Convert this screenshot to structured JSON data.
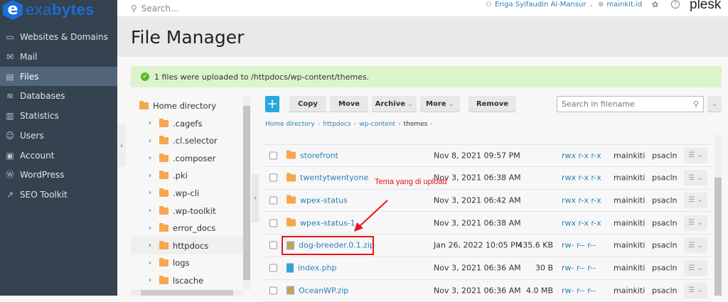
{
  "brand": {
    "logo_letter": "e",
    "logo_prefix": "exa",
    "logo_suffix": "bytes",
    "plesk": "plesk"
  },
  "topbar": {
    "search_placeholder": "Search...",
    "user": "Eriga Syifaudin Al-Mansur",
    "domain": "mainkit.id"
  },
  "sidebar": {
    "items": [
      {
        "label": "Websites & Domains",
        "icon": "monitor-icon"
      },
      {
        "label": "Mail",
        "icon": "mail-icon"
      },
      {
        "label": "Files",
        "icon": "folder-icon",
        "active": true
      },
      {
        "label": "Databases",
        "icon": "database-icon"
      },
      {
        "label": "Statistics",
        "icon": "chart-icon"
      },
      {
        "label": "Users",
        "icon": "user-icon"
      },
      {
        "label": "Account",
        "icon": "account-icon"
      },
      {
        "label": "WordPress",
        "icon": "wordpress-icon"
      },
      {
        "label": "SEO Toolkit",
        "icon": "seo-icon"
      }
    ]
  },
  "page": {
    "title": "File Manager",
    "banner": "1 files were uploaded to /httpdocs/wp-content/themes."
  },
  "tree": {
    "root": "Home directory",
    "items": [
      ".cagefs",
      ".cl.selector",
      ".composer",
      ".pki",
      ".wp-cli",
      ".wp-toolkit",
      "error_docs",
      "httpdocs",
      "logs",
      "lscache"
    ],
    "selected": "httpdocs"
  },
  "toolbar": {
    "add": "+",
    "copy": "Copy",
    "move": "Move",
    "archive": "Archive",
    "more": "More",
    "remove": "Remove",
    "search_placeholder": "Search in filename"
  },
  "breadcrumb": [
    "Home directory",
    "httpdocs",
    "wp-content",
    "themes"
  ],
  "files": [
    {
      "name": "storefront",
      "type": "folder",
      "date": "Nov 8, 2021 09:57 PM",
      "size": "",
      "perms": "rwx r-x r-x",
      "owner": "mainkiti",
      "group": "psacln"
    },
    {
      "name": "twentytwentyone",
      "type": "folder",
      "date": "Nov 3, 2021 06:38 AM",
      "size": "",
      "perms": "rwx r-x r-x",
      "owner": "mainkiti",
      "group": "psacln"
    },
    {
      "name": "wpex-status",
      "type": "folder",
      "date": "Nov 3, 2021 06:42 AM",
      "size": "",
      "perms": "rwx r-x r-x",
      "owner": "mainkiti",
      "group": "psacln"
    },
    {
      "name": "wpex-status-1",
      "type": "folder",
      "date": "Nov 3, 2021 06:38 AM",
      "size": "",
      "perms": "rwx r-x r-x",
      "owner": "mainkiti",
      "group": "psacln"
    },
    {
      "name": "dog-breeder.0.1.zip",
      "type": "zip",
      "date": "Jan 26, 2022 10:05 PM",
      "size": "435.6 KB",
      "perms": "rw- r-- r--",
      "owner": "mainkiti",
      "group": "psacln"
    },
    {
      "name": "index.php",
      "type": "php",
      "date": "Nov 3, 2021 06:36 AM",
      "size": "30 B",
      "perms": "rw- r-- r--",
      "owner": "mainkiti",
      "group": "psacln"
    },
    {
      "name": "OceanWP.zip",
      "type": "zip",
      "date": "Nov 3, 2021 06:36 AM",
      "size": "4.0 MB",
      "perms": "rw- r-- r--",
      "owner": "mainkiti",
      "group": "psacln"
    }
  ],
  "annotation": {
    "text": "Tema yang di upload",
    "color": "#e8131b"
  }
}
